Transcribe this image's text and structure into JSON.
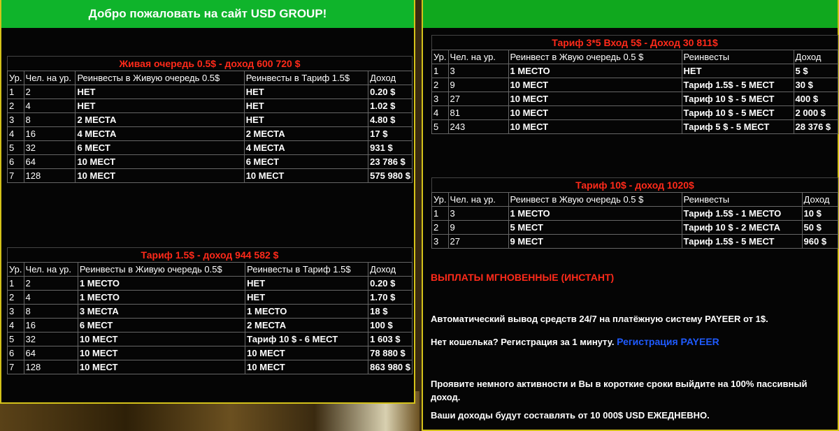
{
  "left_panel": {
    "header": "Добро пожаловать на сайт USD GROUP!",
    "table1": {
      "title": "Живая очередь 0.5$ - доход 600 720 $",
      "columns": [
        "Ур.",
        "Чел. на ур.",
        "Реинвесты в Живую очередь 0.5$",
        "Реинвесты в Тариф 1.5$",
        "Доход"
      ],
      "rows": [
        [
          "1",
          "2",
          "НЕТ",
          "НЕТ",
          "0.20 $"
        ],
        [
          "2",
          "4",
          "НЕТ",
          "НЕТ",
          "1.02 $"
        ],
        [
          "3",
          "8",
          "2 МЕСТА",
          "НЕТ",
          "4.80 $"
        ],
        [
          "4",
          "16",
          "4 МЕСТА",
          "2 МЕСТА",
          "17 $"
        ],
        [
          "5",
          "32",
          "6 МЕСТ",
          "4 МЕСТА",
          "931 $"
        ],
        [
          "6",
          "64",
          "10 МЕСТ",
          "6 МЕСТ",
          "23 786 $"
        ],
        [
          "7",
          "128",
          "10 МЕСТ",
          "10 МЕСТ",
          "575 980 $"
        ]
      ]
    },
    "table2": {
      "title": "Тариф 1.5$ - доход 944 582 $",
      "columns": [
        "Ур.",
        "Чел. на ур.",
        "Реинвесты в Живую очередь 0.5$",
        "Реинвесты в Тариф 1.5$",
        "Доход"
      ],
      "rows": [
        [
          "1",
          "2",
          "1 МЕСТО",
          "НЕТ",
          "0.20 $"
        ],
        [
          "2",
          "4",
          "1 МЕСТО",
          "НЕТ",
          "1.70 $"
        ],
        [
          "3",
          "8",
          "3 МЕСТА",
          "1 МЕСТО",
          "18 $"
        ],
        [
          "4",
          "16",
          "6 МЕСТ",
          "2 МЕСТА",
          "100 $"
        ],
        [
          "5",
          "32",
          "10 МЕСТ",
          "Тариф 10 $ - 6 МЕСТ",
          "1 603 $"
        ],
        [
          "6",
          "64",
          "10 МЕСТ",
          "10 МЕСТ",
          "78 880 $"
        ],
        [
          "7",
          "128",
          "10 МЕСТ",
          "10 МЕСТ",
          "863 980 $"
        ]
      ]
    }
  },
  "right_panel": {
    "table3": {
      "title": "Тариф 3*5 Вход 5$ - Доход 30 811$",
      "columns": [
        "Ур.",
        "Чел. на ур.",
        "Реинвест в Жвую очередь 0.5 $",
        "Реинвесты",
        "Доход"
      ],
      "rows": [
        [
          "1",
          "3",
          "1 МЕСТО",
          "НЕТ",
          "5 $"
        ],
        [
          "2",
          "9",
          "10 МЕСТ",
          "Тариф 1.5$ - 5 МЕСТ",
          "30 $"
        ],
        [
          "3",
          "27",
          "10 МЕСТ",
          "Тариф 10 $ - 5 МЕСТ",
          "400 $"
        ],
        [
          "4",
          "81",
          "10 МЕСТ",
          "Тариф 10 $ - 5 МЕСТ",
          "2 000 $"
        ],
        [
          "5",
          "243",
          "10 МЕСТ",
          "Тариф 5 $ - 5 МЕСТ",
          "28 376 $"
        ]
      ]
    },
    "table4": {
      "title": "Тариф 10$ - доход 1020$",
      "columns": [
        "Ур.",
        "Чел. на ур.",
        "Реинвест в Жвую очередь 0.5 $",
        "Реинвесты",
        "Доход"
      ],
      "rows": [
        [
          "1",
          "3",
          "1 МЕСТО",
          "Тариф 1.5$ - 1 МЕСТО",
          "10 $"
        ],
        [
          "2",
          "9",
          "5 МЕСТ",
          "Тариф 10 $ - 2 МЕСТА",
          "50 $"
        ],
        [
          "3",
          "27",
          "9 МЕСТ",
          "Тариф 1.5$ - 5 МЕСТ",
          "960 $"
        ]
      ]
    },
    "payouts_heading": "ВЫПЛАТЫ МГНОВЕННЫЕ (ИНСТАНТ)",
    "auto_withdraw": "Автоматический вывод средств 24/7 на платёжную систему PAYEER от 1$.",
    "no_wallet": "Нет кошелька? Регистрация за 1 минуту.",
    "register_link": "Регистрация PAYEER",
    "activity": "Проявите немного активности и Вы в короткие сроки выйдите на 100% пассивный доход.",
    "income": "Ваши доходы будут составлять от 10 000$ USD ЕЖЕДНЕВНО."
  },
  "colors": {
    "header_green": "#0fb42b",
    "title_red": "#ff2a1a",
    "link_blue": "#1f5bff",
    "border_yellow": "#d4c21a"
  }
}
